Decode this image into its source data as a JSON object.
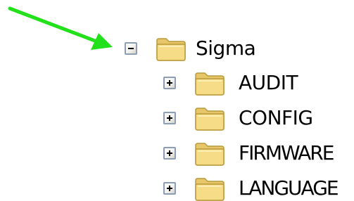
{
  "tree": {
    "root": {
      "label": "Sigma",
      "expanded": true,
      "expander_icon": "minus-icon",
      "icon": "folder-icon"
    },
    "children": [
      {
        "label": "AUDIT",
        "expanded": false,
        "expander_icon": "plus-icon",
        "icon": "folder-icon"
      },
      {
        "label": "CONFIG",
        "expanded": false,
        "expander_icon": "plus-icon",
        "icon": "folder-icon"
      },
      {
        "label": "FIRMWARE",
        "expanded": false,
        "expander_icon": "plus-icon",
        "icon": "folder-icon"
      },
      {
        "label": "LANGUAGE",
        "expanded": false,
        "expander_icon": "plus-icon",
        "icon": "folder-icon"
      }
    ]
  },
  "annotation": {
    "icon": "arrow-icon",
    "color": "#22e01a"
  },
  "colors": {
    "folder_fill": "#f6dc86",
    "folder_outline": "#b89a3a",
    "expander_border": "#8c9db8"
  }
}
